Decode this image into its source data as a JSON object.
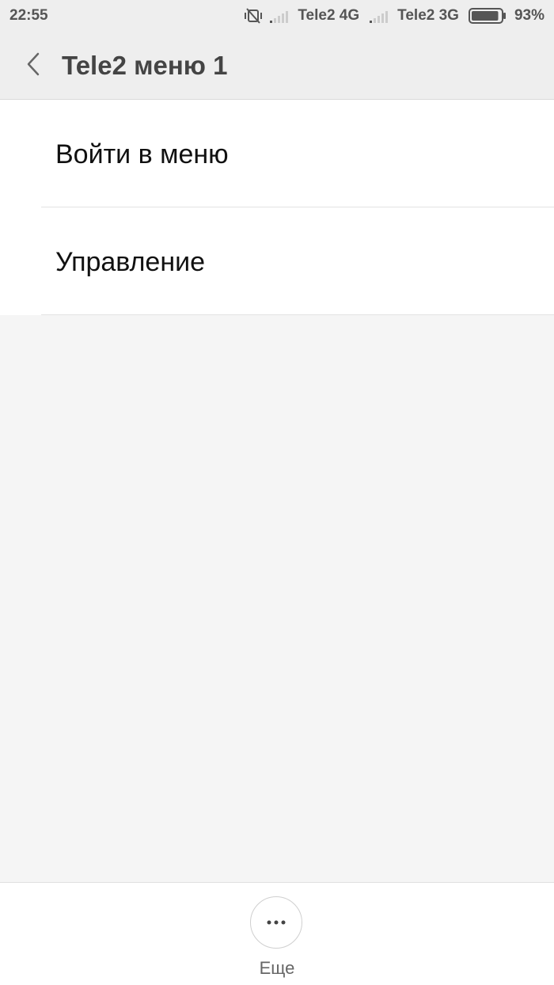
{
  "status_bar": {
    "time": "22:55",
    "icons": {
      "mute": "vibrate-off-icon",
      "signal": "signal-bars-icon",
      "battery": "battery-icon"
    },
    "sim1_label": "Tele2 4G",
    "sim2_label": "Tele2 3G",
    "battery_percent": "93%",
    "battery_level": 0.93
  },
  "header": {
    "back_icon": "chevron-left-icon",
    "title": "Tele2 меню 1"
  },
  "menu": {
    "items": [
      {
        "label": "Войти в меню"
      },
      {
        "label": "Управление"
      }
    ]
  },
  "bottom_bar": {
    "more_icon": "more-dots-icon",
    "more_label": "Еще"
  },
  "colors": {
    "background": "#f5f5f5",
    "bar": "#eeeeee",
    "title_text": "#444444",
    "item_text": "#111111"
  }
}
